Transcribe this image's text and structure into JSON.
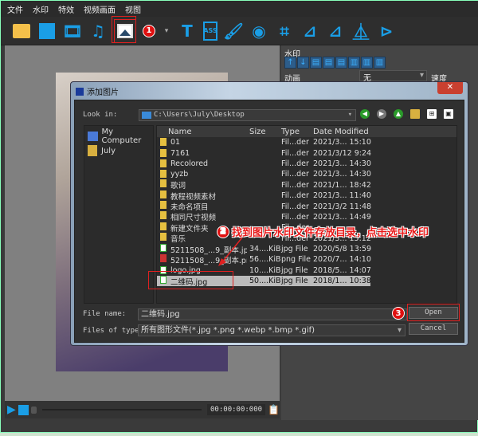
{
  "menu": [
    "文件",
    "水印",
    "特效",
    "视频画面",
    "视图"
  ],
  "toolbar": {
    "icons": [
      "folder-icon",
      "save-icon",
      "video-icon",
      "music-icon",
      "image-icon",
      "camera-icon",
      "text-icon",
      "ass-subtitle-icon",
      "paint-roller-icon",
      "bucket-icon",
      "crop-icon",
      "rotate-left-icon",
      "rotate-right-icon",
      "flip-horizontal-icon",
      "flip-vertical-icon"
    ],
    "step1": "1"
  },
  "right_panel": {
    "title": "水印",
    "animation_label": "动画",
    "animation_value": "无",
    "speed_label": "速度"
  },
  "controls": {
    "time": "00:00:00:000"
  },
  "dialog": {
    "title": "添加图片",
    "close": "✕",
    "look_in_label": "Look in:",
    "look_in_value": "C:\\Users\\July\\Desktop",
    "places": [
      "My Computer",
      "July"
    ],
    "columns": [
      "Name",
      "Size",
      "Type",
      "Date Modified"
    ],
    "files": [
      {
        "name": "01",
        "size": "",
        "type": "Fil...der",
        "date": "2021/3... 15:10",
        "kind": "folder"
      },
      {
        "name": "7161",
        "size": "",
        "type": "Fil...der",
        "date": "2021/3/12 9:24",
        "kind": "folder"
      },
      {
        "name": "Recolored",
        "size": "",
        "type": "Fil...der",
        "date": "2021/3... 14:30",
        "kind": "folder"
      },
      {
        "name": "yyzb",
        "size": "",
        "type": "Fil...der",
        "date": "2021/3... 14:30",
        "kind": "folder"
      },
      {
        "name": "歌词",
        "size": "",
        "type": "Fil...der",
        "date": "2021/1... 18:42",
        "kind": "folder"
      },
      {
        "name": "教程视频素材",
        "size": "",
        "type": "Fil...der",
        "date": "2021/3... 11:40",
        "kind": "folder"
      },
      {
        "name": "未命名项目",
        "size": "",
        "type": "Fil...der",
        "date": "2021/3/2 11:48",
        "kind": "folder"
      },
      {
        "name": "相同尺寸视频",
        "size": "",
        "type": "Fil...der",
        "date": "2021/3... 14:49",
        "kind": "folder"
      },
      {
        "name": "新建文件夹",
        "size": "",
        "type": "Fil...der",
        "date": "",
        "kind": "folder"
      },
      {
        "name": "音乐",
        "size": "",
        "type": "Fil...der",
        "date": "2021/3... 15:12",
        "kind": "folder"
      },
      {
        "name": "5211508_...9_副本.jpg",
        "size": "34....KiB",
        "type": "jpg File",
        "date": "2020/5/8 13:59",
        "kind": "jpg"
      },
      {
        "name": "5211508_...9_副本.png",
        "size": "56....KiB",
        "type": "png File",
        "date": "2020/7... 14:10",
        "kind": "png"
      },
      {
        "name": "logo.jpg",
        "size": "10....KiB",
        "type": "jpg File",
        "date": "2018/5... 14:07",
        "kind": "jpg"
      },
      {
        "name": "二维码.jpg",
        "size": "50....KiB",
        "type": "jpg File",
        "date": "2018/1... 10:38",
        "kind": "jpg",
        "selected": true
      }
    ],
    "file_name_label": "File name:",
    "file_name_value": "二维码.jpg",
    "file_type_label": "Files of type:",
    "file_type_value": "所有图形文件(*.jpg *.png *.webp *.bmp *.gif)",
    "open": "Open",
    "cancel": "Cancel"
  },
  "annotations": {
    "step2": "2",
    "step2_text": "找到图片水印文件存放目录，点击选中水印",
    "step3": "3"
  },
  "colors": {
    "accent": "#1a9ee6",
    "annotation": "#e02020"
  }
}
